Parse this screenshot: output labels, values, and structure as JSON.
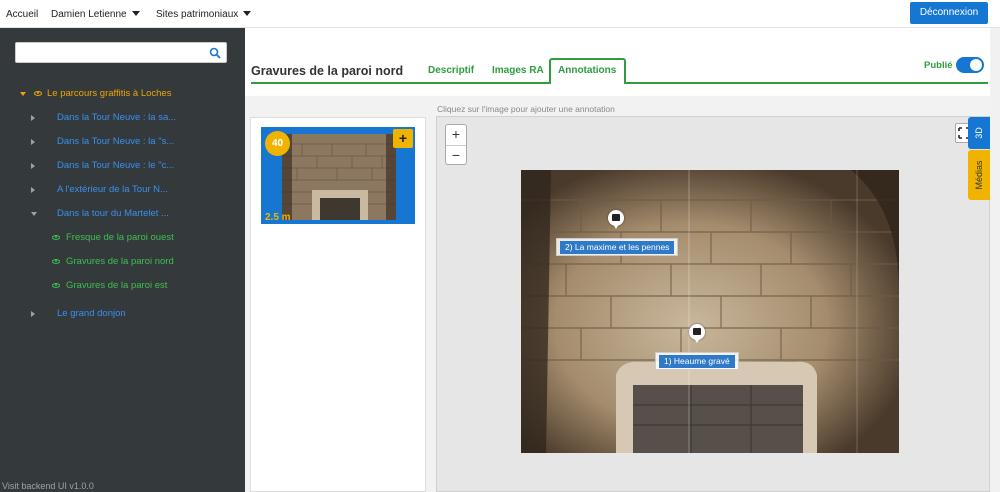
{
  "topnav": {
    "home": "Accueil",
    "user": "Damien Letienne",
    "sites": "Sites patrimoniaux",
    "logout": "Déconnexion"
  },
  "sidebar": {
    "search_value": "",
    "items": [
      {
        "label": "Le parcours graffitis à Loches",
        "level": 0,
        "expanded": true,
        "visible_icon": true,
        "color": "#f0a500"
      },
      {
        "label": "Dans la Tour Neuve : la sa...",
        "level": 1,
        "expanded": false,
        "color": "#3b8ef0"
      },
      {
        "label": "Dans la Tour Neuve : la \"s...",
        "level": 1,
        "expanded": false,
        "color": "#3b8ef0"
      },
      {
        "label": "Dans la Tour Neuve : le \"c...",
        "level": 1,
        "expanded": false,
        "color": "#3b8ef0"
      },
      {
        "label": "A l'extérieur de la Tour N...",
        "level": 1,
        "expanded": false,
        "color": "#3b8ef0"
      },
      {
        "label": "Dans la tour du Martelet ...",
        "level": 1,
        "expanded": true,
        "color": "#3b8ef0"
      },
      {
        "label": "Fresque de la paroi ouest",
        "level": 2,
        "color": "#3fbf4f"
      },
      {
        "label": "Gravures de la paroi nord",
        "level": 2,
        "color": "#3fbf4f"
      },
      {
        "label": "Gravures de la paroi est",
        "level": 2,
        "color": "#3fbf4f"
      },
      {
        "label": "Le grand donjon",
        "level": 1,
        "expanded": false,
        "color": "#3b8ef0"
      }
    ],
    "version": "Visit backend UI v1.0.0"
  },
  "main": {
    "title": "Gravures de la paroi nord",
    "tabs": [
      {
        "label": "Descriptif",
        "active": false
      },
      {
        "label": "Images RA",
        "active": false
      },
      {
        "label": "Annotations",
        "active": true
      }
    ],
    "published_label": "Publié",
    "published": true
  },
  "media": {
    "badge": "40",
    "add": "+",
    "size": "2.5 m"
  },
  "viewer": {
    "hint": "Cliquez sur l'image pour ajouter une annotation",
    "zoom_in": "+",
    "zoom_out": "−",
    "annotations": [
      {
        "label": "2) La maxime et les pennes"
      },
      {
        "label": "1) Heaume gravé"
      }
    ],
    "side_tabs": {
      "three_d": "3D",
      "medias": "Médias"
    }
  },
  "colors": {
    "primary_blue": "#1677d2",
    "green": "#2e9c3f",
    "orange": "#f0b400",
    "sidebar_bg": "#343a3c"
  }
}
